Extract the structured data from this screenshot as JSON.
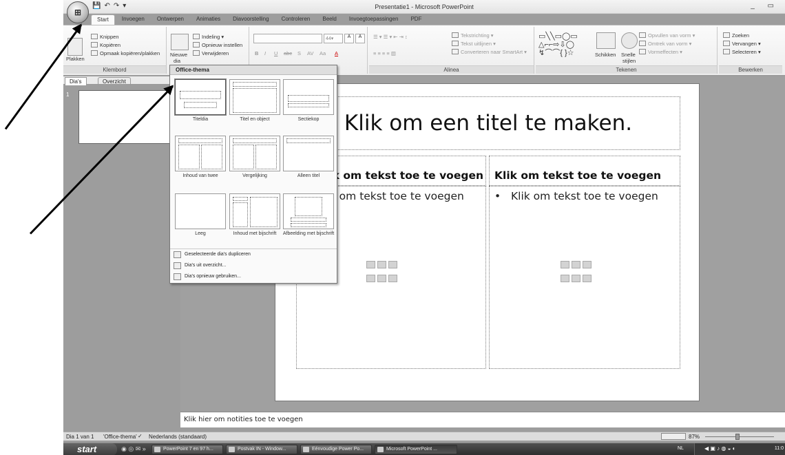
{
  "window": {
    "title": "Presentatie1 - Microsoft PowerPoint",
    "qat": [
      "💾",
      "↶",
      "↷",
      "▾"
    ],
    "controls": "_ ▭"
  },
  "tabs": [
    "Start",
    "Invoegen",
    "Ontwerpen",
    "Animaties",
    "Diavoorstelling",
    "Controleren",
    "Beeld",
    "Invoegtoepassingen",
    "PDF"
  ],
  "ribbon": {
    "clipboard": {
      "paste": "Plakken",
      "cut": "Knippen",
      "copy": "Kopiëren",
      "format_painter": "Opmaak kopiëren/plakken",
      "label": "Klembord"
    },
    "slides": {
      "new_slide": "Nieuwe",
      "new_slide2": "dia",
      "layout": "Indeling",
      "reset": "Opnieuw instellen",
      "delete": "Verwijderen",
      "label": "Dia's"
    },
    "font": {
      "size": "44",
      "bold": "B",
      "italic": "I",
      "underline": "U",
      "strike": "abc",
      "shadow": "S",
      "spacing": "AV",
      "case": "Aa",
      "color": "A",
      "grow": "A",
      "shrink": "A"
    },
    "paragraph": {
      "text_direction": "Tekstrichting",
      "align_text": "Tekst uitlijnen",
      "smartart": "Converteren naar SmartArt",
      "label": "Alinea"
    },
    "drawing": {
      "arrange": "Schikken",
      "quick_styles": "Snelle",
      "quick_styles2": "stijlen",
      "fill": "Opvullen van vorm",
      "outline": "Omtrek van vorm",
      "effects": "Vormeffecten",
      "label": "Tekenen"
    },
    "editing": {
      "find": "Zoeken",
      "replace": "Vervangen",
      "select": "Selecteren",
      "label": "Bewerken"
    }
  },
  "pane": {
    "tab_slides": "Dia's",
    "tab_outline": "Overzicht",
    "slide_number": "1"
  },
  "gallery": {
    "header": "Office-thema",
    "layouts": [
      "Titeldia",
      "Titel en object",
      "Sectiekop",
      "Inhoud van twee",
      "Vergelijking",
      "Alleen titel",
      "Leeg",
      "Inhoud met bijschrift",
      "Afbeelding met bijschrift"
    ],
    "commands": [
      "Geselecteerde dia's dupliceren",
      "Dia's uit overzicht...",
      "Dia's opnieuw gebruiken..."
    ]
  },
  "slide": {
    "title": "Klik om een titel te maken.",
    "left_heading": "Klik om tekst toe te voegen",
    "left_body": "Klik om tekst toe te voegen",
    "right_heading": "Klik om tekst toe te voegen",
    "right_body": "Klik om tekst toe te voegen",
    "bullet": "•"
  },
  "notes": "Klik hier om notities toe te voegen",
  "status": {
    "slide": "Dia 1 van 1",
    "theme": "'Office-thema'",
    "language": "Nederlands (standaard)",
    "zoom": "87%"
  },
  "taskbar": {
    "start": "start",
    "tasks": [
      "PowerPoint 7 en 97 h...",
      "Postvak IN - Window...",
      "Eénvoudige Power Po...",
      "Microsoft PowerPoint ..."
    ],
    "lang": "NL",
    "time": "11:0"
  }
}
